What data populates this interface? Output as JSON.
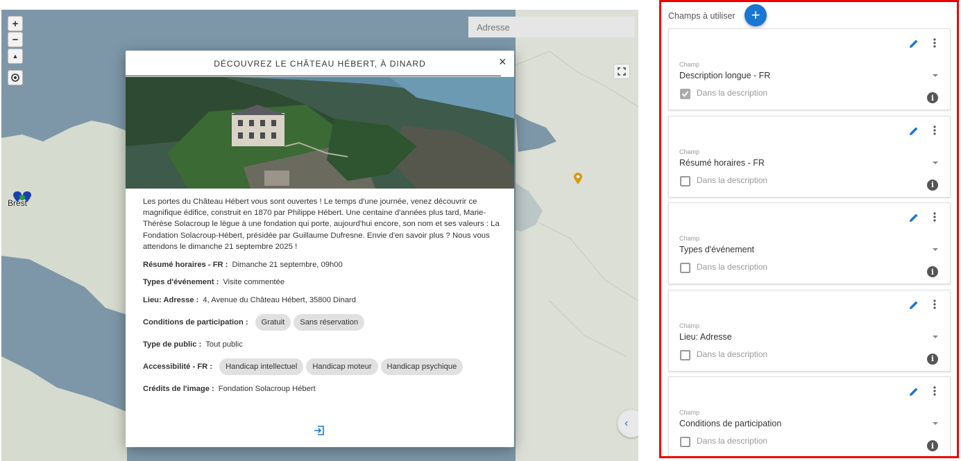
{
  "map": {
    "zoom_in": "+",
    "zoom_out": "−",
    "north": "▲",
    "address_placeholder": "Adresse",
    "city_label": "Brest",
    "colors": {
      "sea": "#7d97a8",
      "land": "#d8dcd2",
      "pin_blue": "#1a3fb0",
      "pin_green": "#2a9d3a",
      "pin_orange": "#d69a1a"
    }
  },
  "modal": {
    "title": "DÉCOUVREZ LE CHÂTEAU HÉBERT, À DINARD",
    "close": "×",
    "description": "Les portes du Château Hébert vous sont ouvertes ! Le temps d'une journée, venez découvrir ce magnifique édifice, construit en 1870 par Philippe Hébert. Une centaine d'années plus tard, Marie-Thérèse Solacroup le lègue à une fondation qui porte, aujourd'hui encore, son nom et ses valeurs : La Fondation Solacroup-Hébert, présidée par Guillaume Dufresne. Envie d'en savoir plus ? Nous vous attendons le dimanche 21 septembre 2025 !",
    "rows": [
      {
        "label": "Résumé horaires - FR :",
        "value": "Dimanche 21 septembre, 09h00"
      },
      {
        "label": "Types d'événement :",
        "value": "Visite commentée"
      },
      {
        "label": "Lieu: Adresse :",
        "value": "4, Avenue du Château Hébert, 35800 Dinard"
      },
      {
        "label": "Conditions de participation :",
        "chips": [
          "Gratuit",
          "Sans réservation"
        ]
      },
      {
        "label": "Type de public :",
        "value": "Tout public"
      },
      {
        "label": "Accessibilité - FR :",
        "chips": [
          "Handicap intellectuel",
          "Handicap moteur",
          "Handicap psychique"
        ]
      },
      {
        "label": "Crédits de l'image :",
        "value": "Fondation Solacroup Hébert"
      }
    ]
  },
  "panel": {
    "title": "Champs à utiliser",
    "add": "+",
    "cards": [
      {
        "field_label": "Champ",
        "field_value": "Description longue - FR",
        "checkbox_label": "Dans la description",
        "checked": true
      },
      {
        "field_label": "Champ",
        "field_value": "Résumé horaires - FR",
        "checkbox_label": "Dans la description",
        "checked": false
      },
      {
        "field_label": "Champ",
        "field_value": "Types d'événement",
        "checkbox_label": "Dans la description",
        "checked": false
      },
      {
        "field_label": "Champ",
        "field_value": "Lieu: Adresse",
        "checkbox_label": "Dans la description",
        "checked": false
      },
      {
        "field_label": "Champ",
        "field_value": "Conditions de participation",
        "checkbox_label": "Dans la description",
        "checked": false
      }
    ],
    "accent": "#1976d2",
    "highlight_border": "#e00000"
  }
}
